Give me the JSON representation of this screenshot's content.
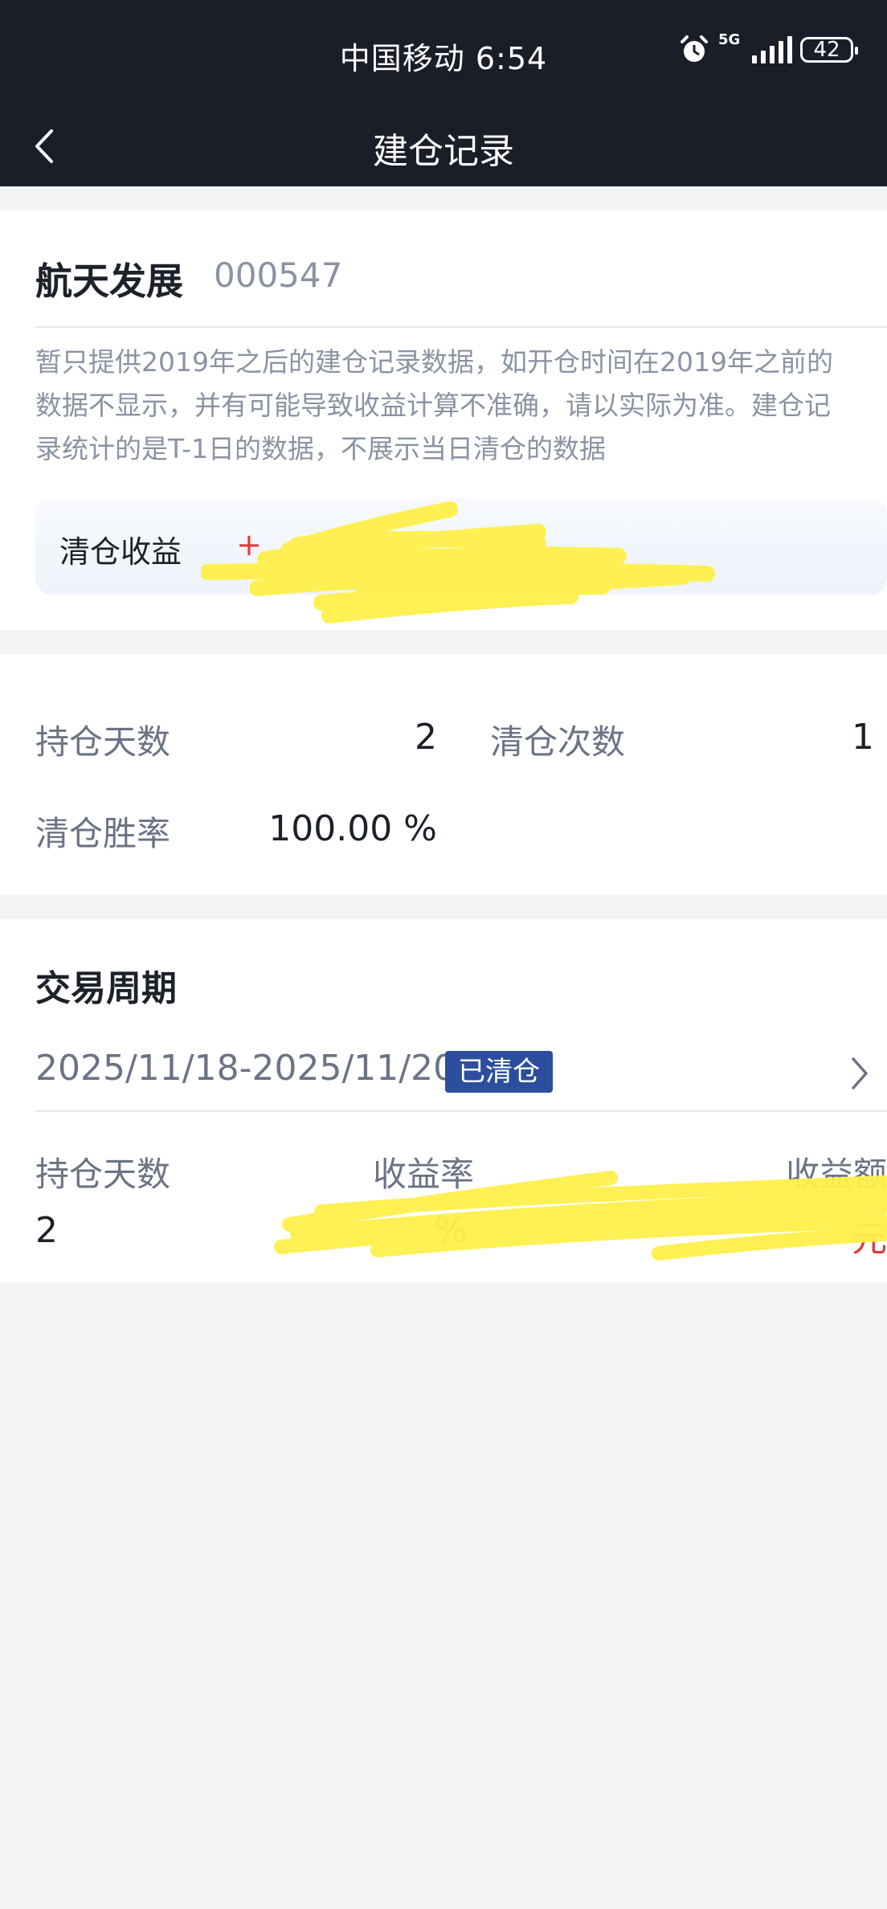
{
  "status_bar": {
    "carrier_time": "中国移动 6:54",
    "network": "5G",
    "battery": "42"
  },
  "nav": {
    "title": "建仓记录",
    "back_icon": "chevron-left-icon"
  },
  "stock": {
    "name": "航天发展",
    "code": "000547",
    "notice_lines": [
      "暂只提供2019年之后的建仓记录数据，如开仓时间在2019年之前的",
      "数据不显示，并有可能导致收益计算不准确，请以实际为准。建仓记",
      "录统计的是T-1日的数据，不展示当日清仓的数据"
    ],
    "profit_label": "清仓收益",
    "profit_value": "+"
  },
  "stats": {
    "hold_days_label": "持仓天数",
    "hold_days_value": "2",
    "clear_count_label": "清仓次数",
    "clear_count_value": "1",
    "win_rate_label": "清仓胜率",
    "win_rate_value": "100.00 %"
  },
  "trade_period": {
    "title": "交易周期",
    "range": "2025/11/18-2025/11/20",
    "status": "已清仓",
    "headers": [
      "持仓天数",
      "收益率",
      "收益额"
    ],
    "values": [
      "2",
      "%",
      "元"
    ]
  },
  "colors": {
    "header_bg": "#1b1e29",
    "tag_bg": "#2d4e9e",
    "profit_red": "#e23b3b",
    "scribble_yellow": "#fff04a"
  }
}
